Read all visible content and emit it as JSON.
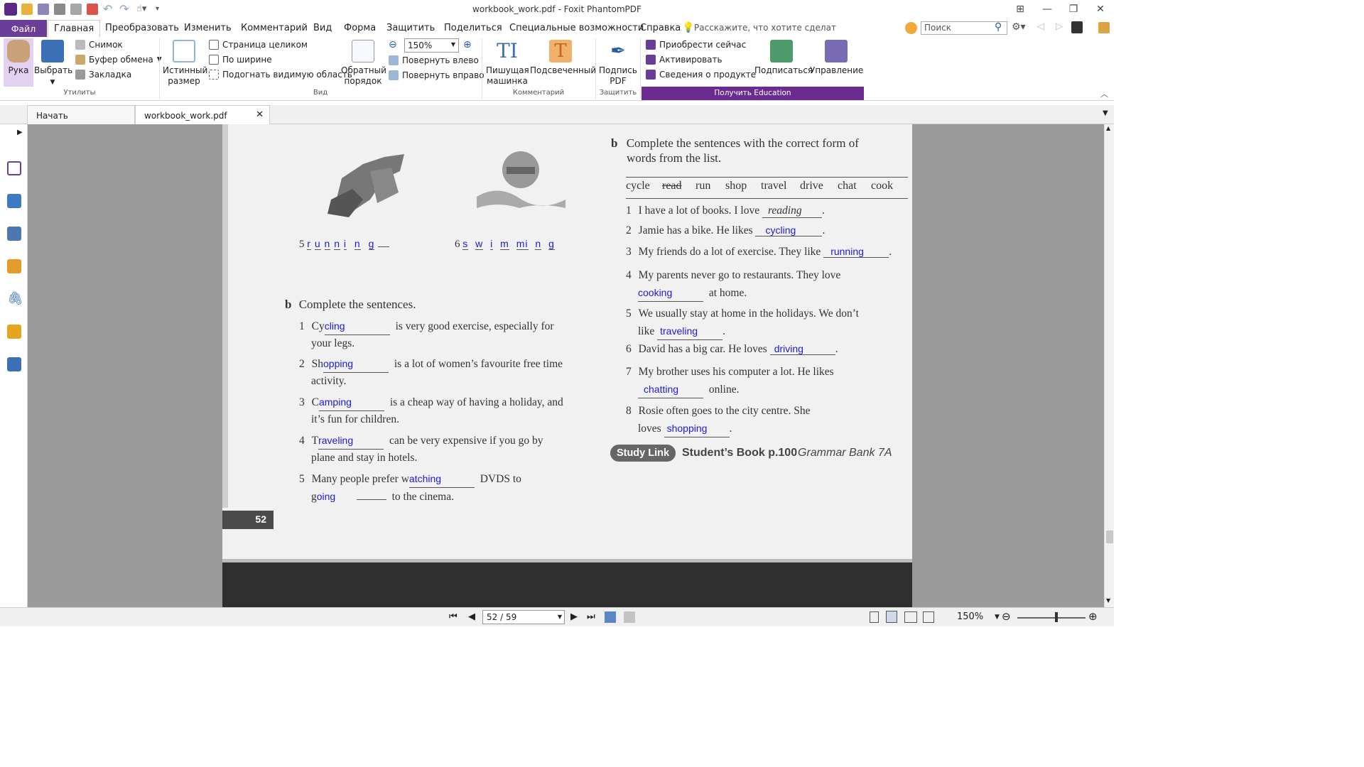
{
  "window": {
    "title": "workbook_work.pdf - Foxit PhantomPDF"
  },
  "menu": {
    "file": "Файл",
    "tabs": [
      "Главная",
      "Преобразовать",
      "Изменить",
      "Комментарий",
      "Вид",
      "Форма",
      "Защитить",
      "Поделиться",
      "Специальные возможности",
      "Справка"
    ],
    "tell_me": "Расскажите, что хотите сделат",
    "search_placeholder": "Поиск"
  },
  "ribbon": {
    "hand": "Рука",
    "select": "Выбрать",
    "snapshot": "Снимок",
    "clipboard": "Буфер обмена",
    "bookmark": "Закладка",
    "utilities_label": "Утилиты",
    "actual_size": [
      "Истинный",
      "размер"
    ],
    "fit_page": "Страница целиком",
    "fit_width": "По ширине",
    "fit_visible": "Подогнать видимую область",
    "reverse_order": [
      "Обратный",
      "порядок"
    ],
    "zoom_value": "150%",
    "rotate_left": "Повернуть влево",
    "rotate_right": "Повернуть вправо",
    "view_label": "Вид",
    "typewriter": [
      "Пишущая",
      "машинка"
    ],
    "highlight": "Подсвеченный",
    "comment_label": "Комментарий",
    "sign_pdf": [
      "Подпись",
      "PDF"
    ],
    "protect_label": "Защитить",
    "buy_now": "Приобрести сейчас",
    "activate": "Активировать",
    "product_info": "Сведения о продукте",
    "subscribe": "Подписаться",
    "manage": "Управление",
    "get_education": "Получить Education"
  },
  "doc_tabs": {
    "start": "Начать",
    "current": "workbook_work.pdf"
  },
  "pdf": {
    "left": {
      "item5_num": "5",
      "item5_letters": [
        "r",
        "u",
        "n",
        "n",
        "i",
        "n",
        "g"
      ],
      "item6_num": "6",
      "item6_letters": [
        "s",
        "w",
        "i",
        "m",
        "mi",
        "n",
        "g"
      ],
      "section_letter": "b",
      "section_title": "Complete the sentences.",
      "sentences": [
        {
          "num": "1",
          "prefix": "Cy",
          "answer": "cling",
          "rest": "is very good exercise, especially for",
          "line2": "your legs."
        },
        {
          "num": "2",
          "prefix": "Sh",
          "answer": "opping",
          "rest": "is a lot of women’s favourite free time",
          "line2": "activity."
        },
        {
          "num": "3",
          "prefix": "C",
          "answer": "amping",
          "rest": "is a cheap way of having a holiday, and",
          "line2": "it’s fun for children."
        },
        {
          "num": "4",
          "prefix": "T",
          "answer": "raveling",
          "rest": "can be very expensive if you go by",
          "line2": "plane and stay in hotels."
        }
      ],
      "s5_num": "5",
      "s5_text": "Many people prefer w",
      "s5_answer": "atching",
      "s5_rest": "DVDS to",
      "s5_line2_prefix": "g",
      "s5_line2_answer": "oing",
      "s5_line2_rest": "to the cinema.",
      "page_number": "52"
    },
    "right": {
      "section_letter": "b",
      "title_line1": "Complete the sentences with the correct form of",
      "title_line2": "words from the list.",
      "word_list": [
        "cycle",
        "read",
        "run",
        "shop",
        "travel",
        "drive",
        "chat",
        "cook"
      ],
      "items": [
        {
          "num": "1",
          "text": "I have a lot of books. I love",
          "answer": "reading",
          "after": "."
        },
        {
          "num": "2",
          "text": "Jamie has a bike. He likes",
          "answer": "cycling",
          "after": "."
        },
        {
          "num": "3",
          "text": "My friends do a lot of exercise. They like",
          "answer": "running",
          "after": "."
        }
      ],
      "item4_num": "4",
      "item4_line1": "My parents never go to restaurants. They love",
      "item4_answer": "cooking",
      "item4_after": "at home.",
      "item5_num": "5",
      "item5_line1": "We usually stay at home in the holidays. We don’t",
      "item5_prefix": "like",
      "item5_answer": "traveling",
      "item5_after": ".",
      "item6_num": "6",
      "item6_text": "David has a big car. He loves",
      "item6_answer": "driving",
      "item6_after": ".",
      "item7_num": "7",
      "item7_line1": "My brother uses his computer a lot. He likes",
      "item7_answer": "chatting",
      "item7_after": "online.",
      "item8_num": "8",
      "item8_line1": "Rosie often goes to the city centre. She",
      "item8_prefix": "loves",
      "item8_answer": "shopping",
      "item8_after": ".",
      "study_link": "Study Link",
      "students_book": "Student’s Book p.100",
      "grammar_bank": "Grammar Bank 7A"
    }
  },
  "status": {
    "page": "52 / 59",
    "zoom": "150%"
  },
  "colors": {
    "brand": "#6a3d97",
    "education_bar": "#6a2c91",
    "ink": "#1a1ad6"
  }
}
